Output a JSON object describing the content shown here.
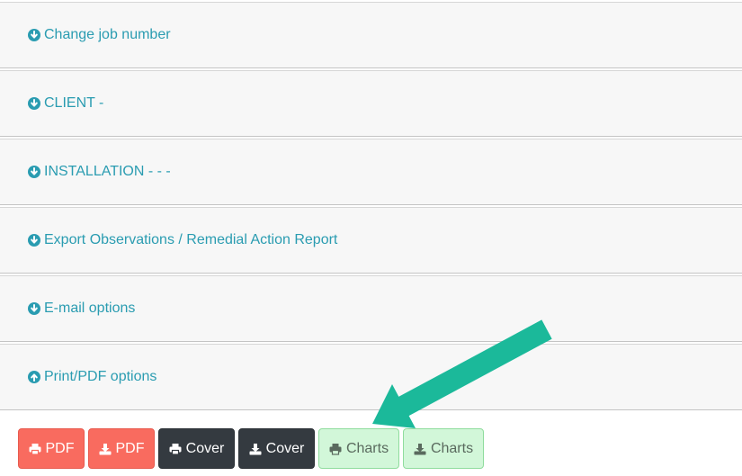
{
  "panels": [
    {
      "label": "Change job number",
      "icon": "arrow-circle-down-icon"
    },
    {
      "label": "CLIENT -",
      "icon": "arrow-circle-down-icon"
    },
    {
      "label": "INSTALLATION - - -",
      "icon": "arrow-circle-down-icon"
    },
    {
      "label": "Export Observations / Remedial Action Report",
      "icon": "arrow-circle-down-icon"
    },
    {
      "label": "E-mail options",
      "icon": "arrow-circle-down-icon"
    },
    {
      "label": "Print/PDF options",
      "icon": "arrow-circle-up-icon"
    }
  ],
  "buttons": [
    {
      "label": "PDF",
      "icon": "print-icon",
      "style": "red"
    },
    {
      "label": "PDF",
      "icon": "download-icon",
      "style": "red"
    },
    {
      "label": "Cover",
      "icon": "print-icon",
      "style": "dark"
    },
    {
      "label": "Cover",
      "icon": "download-icon",
      "style": "dark"
    },
    {
      "label": "Charts",
      "icon": "print-icon",
      "style": "green"
    },
    {
      "label": "Charts",
      "icon": "download-icon",
      "style": "green"
    }
  ],
  "colors": {
    "link": "#2a9cb1",
    "panel_bg": "#f7f7f7",
    "red": "#f96b5f",
    "dark": "#343a40",
    "green": "#d2f7d9",
    "arrow": "#1bb99a"
  }
}
